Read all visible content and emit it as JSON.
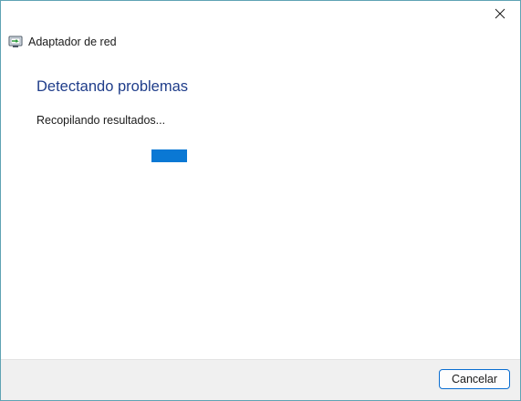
{
  "window": {
    "title": "Adaptador de red",
    "close_icon": "close-icon",
    "app_icon": "network-troubleshooter-icon"
  },
  "main": {
    "heading": "Detectando problemas",
    "status": "Recopilando resultados..."
  },
  "footer": {
    "cancel_label": "Cancelar"
  },
  "colors": {
    "accent": "#0a78d4",
    "heading": "#1f3d8a",
    "border": "#5fa3b4"
  }
}
